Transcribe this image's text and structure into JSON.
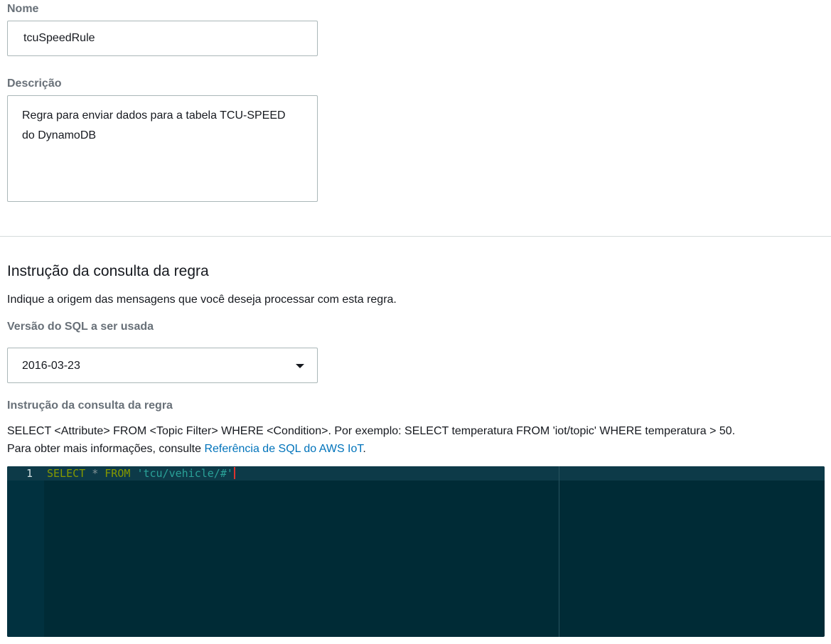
{
  "name": {
    "label": "Nome",
    "value": "tcuSpeedRule"
  },
  "description": {
    "label": "Descrição",
    "line1": "Regra para enviar dados para a tabela TCU-SPEED",
    "line2": "do DynamoDB"
  },
  "query_section": {
    "title": "Instrução da consulta da regra",
    "subtitle": "Indique a origem das mensagens que você deseja processar com esta regra.",
    "sql_version": {
      "label": "Versão do SQL a ser usada",
      "selected": "2016-03-23"
    },
    "statement": {
      "label": "Instrução da consulta da regra",
      "help_line1": "SELECT <Attribute> FROM <Topic Filter> WHERE <Condition>. Por exemplo: SELECT temperatura FROM 'iot/topic' WHERE temperatura > 50.",
      "help_line2_prefix": "Para obter mais informações, consulte ",
      "help_link": "Referência de SQL do AWS IoT",
      "help_line2_suffix": "."
    }
  },
  "editor": {
    "line_number": "1",
    "tokens": {
      "kw1": "SELECT",
      "star": "*",
      "kw2": "FROM",
      "string": "'tcu/vehicle/#'"
    }
  },
  "colors": {
    "editor_bg": "#002b36",
    "keyword": "#859900",
    "string": "#2aa198",
    "link": "#0073bb",
    "cursor": "#dc322f"
  }
}
